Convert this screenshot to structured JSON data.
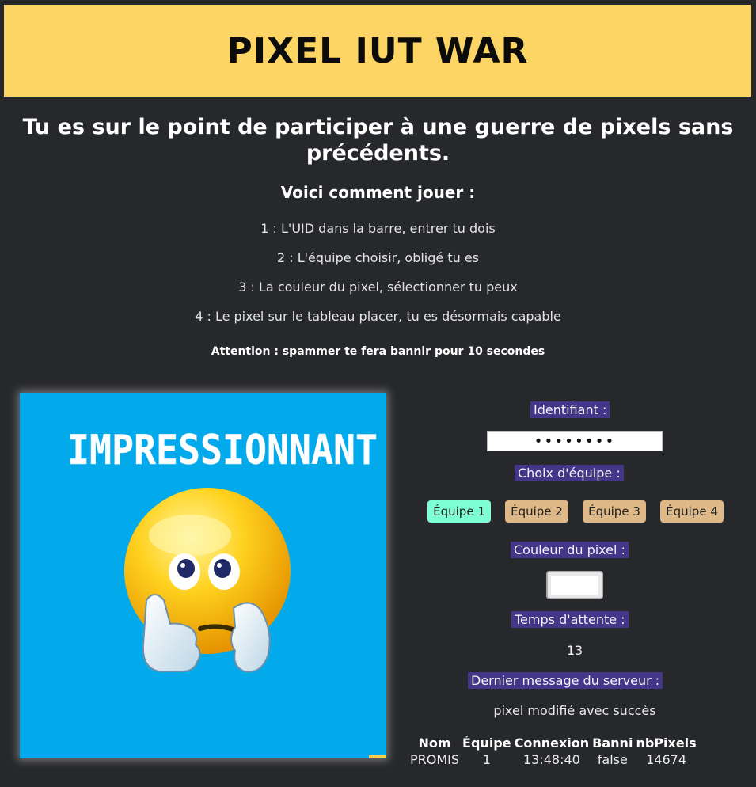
{
  "header": {
    "title": "PIXEL IUT WAR"
  },
  "intro": {
    "headline": "Tu es sur le point de participer à une guerre de pixels sans précédents.",
    "howto_title": "Voici comment jouer :",
    "rules": [
      "1 : L'UID dans la barre, entrer tu dois",
      "2 : L'équipe choisir, obligé tu es",
      "3 : La couleur du pixel, sélectionner tu peux",
      "4 : Le pixel sur le tableau placer, tu es désormais capable"
    ],
    "warning": "Attention : spammer te fera bannir pour 10 secondes"
  },
  "board": {
    "text": "IMPRESSIONNANT",
    "background": "#02aaeb"
  },
  "panel": {
    "uid_label": "Identifiant :",
    "uid_value": "••••••••",
    "team_label": "Choix d'équipe :",
    "teams": [
      "Équipe 1",
      "Équipe 2",
      "Équipe 3",
      "Équipe 4"
    ],
    "selected_team": "Équipe 1",
    "color_label": "Couleur du pixel :",
    "selected_color": "#ffffff",
    "wait_label": "Temps d'attente :",
    "wait_value": "13",
    "server_label": "Dernier message du serveur :",
    "server_message": "pixel modifié avec succès"
  },
  "players_table": {
    "headers": [
      "Nom",
      "Équipe",
      "Connexion",
      "Banni",
      "nbPixels"
    ],
    "rows": [
      [
        "PROMIS",
        "1",
        "13:48:40",
        "false",
        "14674"
      ]
    ]
  },
  "colors": {
    "banner": "#fdd565",
    "label_bg": "#44378a",
    "team_active": "#7fffd4",
    "team_inactive": "#deb887",
    "page_bg": "#27282c"
  }
}
